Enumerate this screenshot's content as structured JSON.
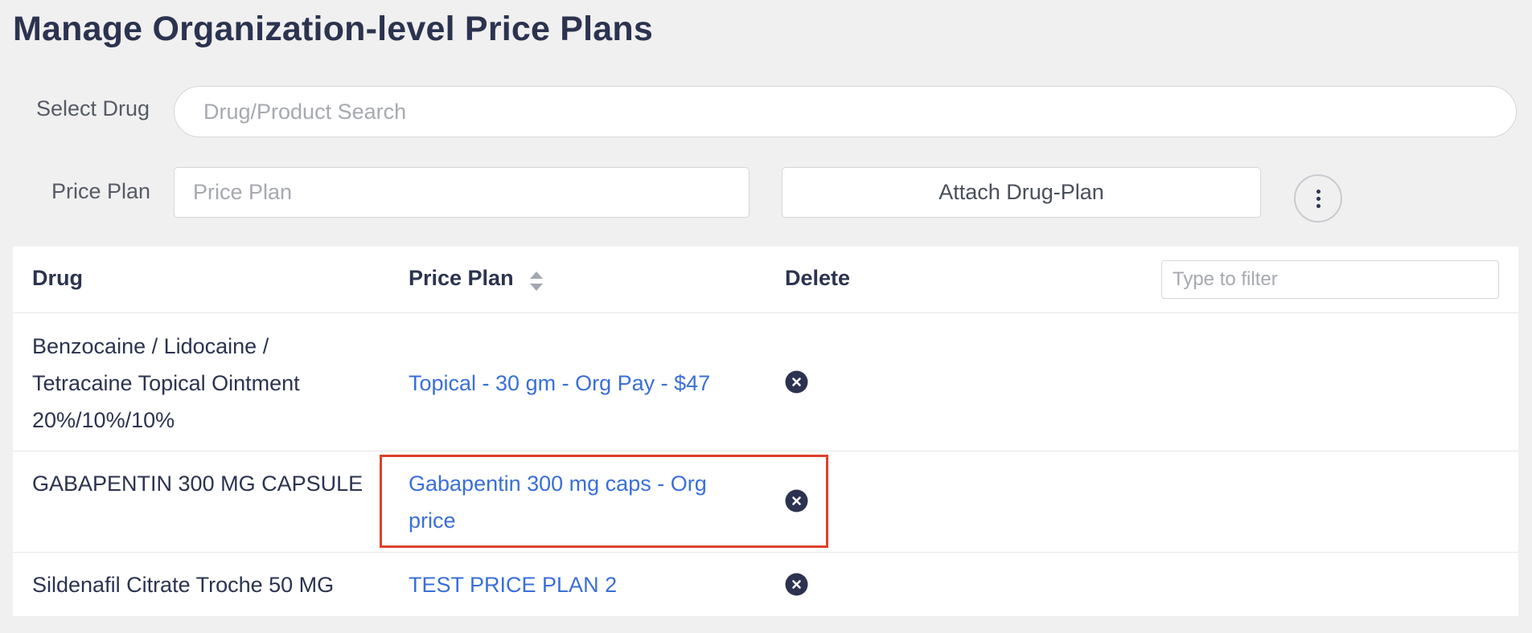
{
  "page": {
    "title": "Manage Organization-level Price Plans"
  },
  "form": {
    "select_drug_label": "Select Drug",
    "drug_search_placeholder": "Drug/Product Search",
    "price_plan_label": "Price Plan",
    "price_plan_placeholder": "Price Plan",
    "attach_button_label": "Attach Drug-Plan",
    "more_options_icon": "vertical-ellipsis-icon"
  },
  "table": {
    "headers": {
      "drug": "Drug",
      "price_plan": "Price Plan",
      "delete": "Delete"
    },
    "sort_icon": "sort-icon",
    "filter_placeholder": "Type to filter",
    "delete_icon": "close-circle-icon",
    "rows": [
      {
        "drug": "Benzocaine / Lidocaine / Tetracaine Topical Ointment 20%/10%/10%",
        "price_plan": "Topical - 30 gm - Org Pay - $47"
      },
      {
        "drug": "GABAPENTIN 300 MG CAPSULE",
        "price_plan": "Gabapentin 300 mg caps - Org price",
        "highlighted": true
      },
      {
        "drug": "Sildenafil Citrate Troche 50 MG",
        "price_plan": "TEST PRICE PLAN 2"
      }
    ]
  },
  "colors": {
    "title": "#2b3350",
    "link": "#3a6fd8",
    "highlight": "#e0402a",
    "background": "#f0f0f0"
  }
}
